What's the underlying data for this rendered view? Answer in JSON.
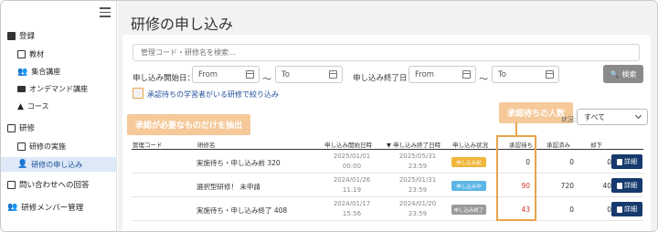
{
  "sidebar": {
    "sections": [
      {
        "label": "登録",
        "items": [
          "教材",
          "集合講座",
          "オンデマンド講座",
          "コース"
        ]
      },
      {
        "label": "研修",
        "items": [
          "研修の実施",
          "研修の申し込み"
        ]
      },
      {
        "label": "問い合わせへの回答"
      },
      {
        "label": "研修メンバー管理"
      }
    ]
  },
  "page": {
    "title": "研修の申し込み"
  },
  "search": {
    "placeholder": "管理コード・研修名を検索..."
  },
  "filters": {
    "start_label": "申し込み開始日：",
    "end_label": "申し込み終了日：",
    "from": "From",
    "to": "To",
    "tilde": "～",
    "search_button": "検索",
    "checkbox_label": "承認待ちの学習者がいる研修で絞り込み"
  },
  "callouts": {
    "filter": "承認が必要なものだけを抽出",
    "pending": "承認待ちの人数"
  },
  "status": {
    "label": "状況:",
    "value": "すべて"
  },
  "table": {
    "headers": [
      "管理コード",
      "研修名",
      "申し込み開始日時",
      "▼ 申し込み終了日時",
      "申し込み状況",
      "承認待ち",
      "承認済み",
      "却下"
    ],
    "rows": [
      {
        "code": "",
        "name": "実施待ち・申し込み前 320",
        "start_date": "2025/01/01",
        "start_time": "00:00",
        "end_date": "2025/05/31",
        "end_time": "23:59",
        "status": "申し込み前",
        "pending": "0",
        "approved": "0",
        "rejected": "0",
        "detail": "詳細"
      },
      {
        "code": "",
        "name": "選択型研修！ 未申請",
        "start_date": "2024/01/26",
        "start_time": "11:19",
        "end_date": "2025/01/31",
        "end_time": "23:59",
        "status": "申し込み中",
        "pending": "90",
        "approved": "720",
        "rejected": "40",
        "detail": "詳細"
      },
      {
        "code": "",
        "name": "実施待ち・申し込み終了 408",
        "start_date": "2024/01/17",
        "start_time": "15:56",
        "end_date": "2024/01/20",
        "end_time": "23:59",
        "status": "申し込み終了",
        "pending": "43",
        "approved": "0",
        "rejected": "0",
        "detail": "詳細"
      }
    ]
  },
  "colors": {
    "accent": "#e8a44a",
    "primary": "#163a6d",
    "badge_before": "#f0b63a",
    "badge_open": "#5bb6e6",
    "badge_closed": "#9a9a9a",
    "pending_text": "#d0342c"
  },
  "icons": [
    "menu-icon",
    "plus-square-icon",
    "book-icon",
    "people-icon",
    "folder-icon",
    "course-icon",
    "training-icon",
    "calendar-icon",
    "person-icon",
    "mail-icon",
    "member-icon",
    "search-icon",
    "document-icon",
    "chevron-down-icon"
  ]
}
